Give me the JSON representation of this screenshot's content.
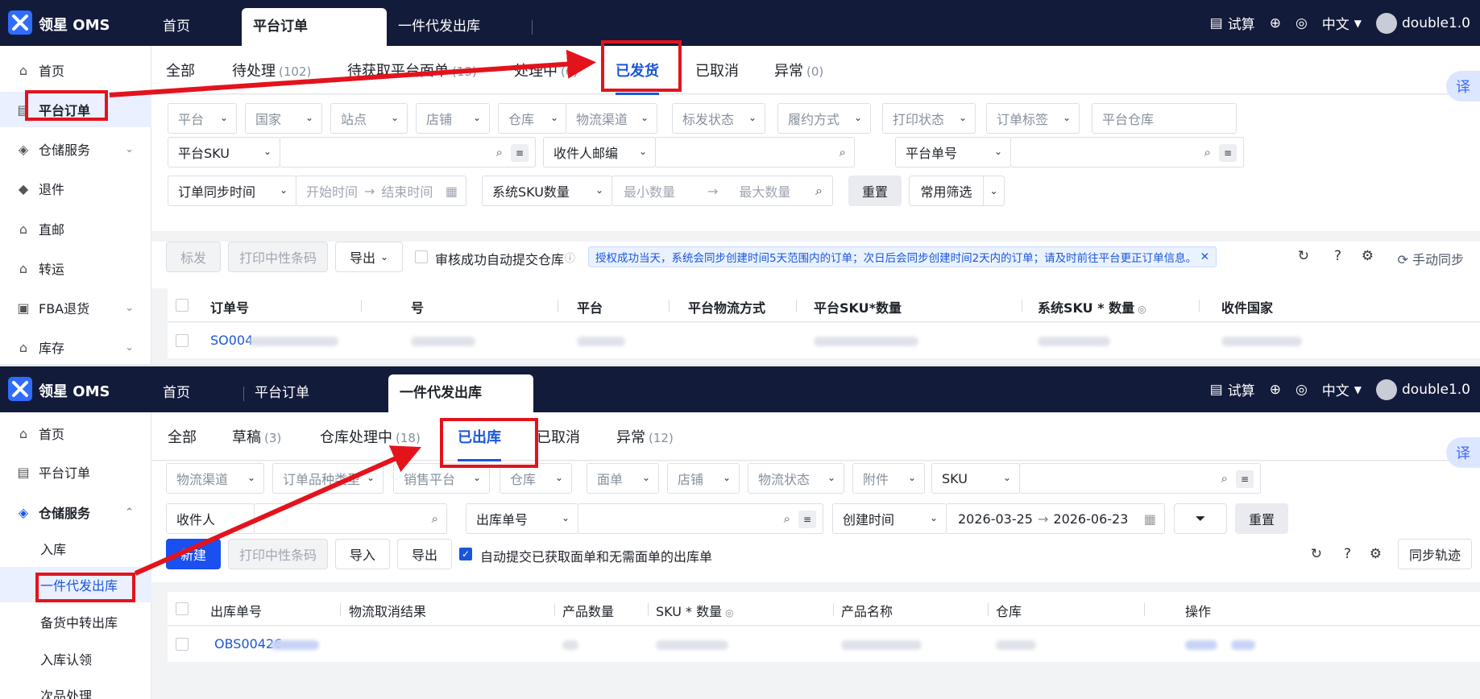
{
  "app": {
    "name": "领星 OMS"
  },
  "header": {
    "trial": "试算",
    "lang": "中文",
    "user": "double1.0"
  },
  "screen1": {
    "tabs": [
      "首页",
      "平台订单",
      "一件代发出库"
    ],
    "sidebar": [
      {
        "label": "首页",
        "icon": "home-icon"
      },
      {
        "label": "平台订单",
        "icon": "order-icon"
      },
      {
        "label": "仓储服务",
        "icon": "warehouse-icon"
      },
      {
        "label": "退件",
        "icon": "return-icon"
      },
      {
        "label": "直邮",
        "icon": "mail-icon"
      },
      {
        "label": "转运",
        "icon": "transfer-icon"
      },
      {
        "label": "FBA退货",
        "icon": "fba-icon"
      },
      {
        "label": "库存",
        "icon": "inventory-icon"
      }
    ],
    "status_tabs": [
      {
        "label": "全部",
        "count": ""
      },
      {
        "label": "待处理",
        "count": "(102)"
      },
      {
        "label": "待获取平台面单",
        "count": "(13)"
      },
      {
        "label": "处理中",
        "count": "(6)"
      },
      {
        "label": "已发货",
        "count": ""
      },
      {
        "label": "已取消",
        "count": ""
      },
      {
        "label": "异常",
        "count": "(0)"
      }
    ],
    "filters_row1": [
      "平台",
      "国家",
      "站点",
      "店铺",
      "仓库",
      "物流渠道",
      "标发状态",
      "履约方式",
      "打印状态",
      "订单标签",
      "平台仓库"
    ],
    "filters_row2": [
      "平台SKU",
      "收件人邮编",
      "平台单号"
    ],
    "filters_row3": {
      "time_type": "订单同步时间",
      "start_placeholder": "开始时间",
      "end_placeholder": "结束时间",
      "qty_type": "系统SKU数量",
      "min_placeholder": "最小数量",
      "max_placeholder": "最大数量",
      "reset": "重置",
      "common_filter": "常用筛选"
    },
    "toolbar": {
      "mark": "标发",
      "print": "打印中性条码",
      "export": "导出",
      "auto_submit": "审核成功自动提交仓库",
      "info": "授权成功当天，系统会同步创建时间5天范围内的订单；次日后会同步创建时间2天内的订单；请及时前往平台更正订单信息。",
      "manual_sync": "手动同步"
    },
    "columns": [
      "订单号",
      "号",
      "平台",
      "平台物流方式",
      "平台SKU*数量",
      "系统SKU * 数量",
      "收件国家"
    ],
    "row": {
      "order_no": "SO004"
    }
  },
  "screen2": {
    "tabs": [
      "首页",
      "平台订单",
      "一件代发出库"
    ],
    "sidebar": [
      {
        "label": "首页",
        "icon": "home-icon"
      },
      {
        "label": "平台订单",
        "icon": "order-icon"
      },
      {
        "label": "仓储服务",
        "icon": "warehouse-icon"
      },
      {
        "label": "入库",
        "icon": ""
      },
      {
        "label": "一件代发出库",
        "icon": ""
      },
      {
        "label": "备货中转出库",
        "icon": ""
      },
      {
        "label": "入库认领",
        "icon": ""
      },
      {
        "label": "次品处理",
        "icon": ""
      }
    ],
    "status_tabs": [
      {
        "label": "全部",
        "count": ""
      },
      {
        "label": "草稿",
        "count": "(3)"
      },
      {
        "label": "仓库处理中",
        "count": "(18)"
      },
      {
        "label": "已出库",
        "count": ""
      },
      {
        "label": "已取消",
        "count": ""
      },
      {
        "label": "异常",
        "count": "(12)"
      }
    ],
    "filters_row1": [
      "物流渠道",
      "订单品种类型",
      "销售平台",
      "仓库",
      "面单",
      "店铺",
      "物流状态",
      "附件"
    ],
    "sku_label": "SKU",
    "recipient_label": "收件人",
    "outbound_no_label": "出库单号",
    "time_type": "创建时间",
    "date_start": "2026-03-25",
    "date_end": "2026-06-23",
    "reset": "重置",
    "toolbar": {
      "new": "新建",
      "print": "打印中性条码",
      "import": "导入",
      "export": "导出",
      "auto_submit": "自动提交已获取面单和无需面单的出库单",
      "sync": "同步轨迹"
    },
    "columns": [
      "出库单号",
      "物流取消结果",
      "产品数量",
      "SKU * 数量",
      "产品名称",
      "仓库",
      "操作"
    ],
    "row": {
      "outbound_no": "OBS00426"
    }
  },
  "colors": {
    "topbar": "#131b3a",
    "accent": "#1a56db",
    "highlight": "#e3131c",
    "primary_button": "#1a4ff0"
  }
}
